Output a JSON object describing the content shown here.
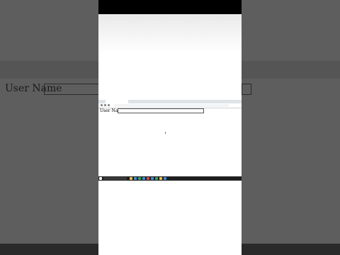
{
  "page": {
    "form_label": "User Name",
    "input_value": ""
  },
  "browser": {
    "tab_title": "",
    "url": ""
  },
  "taskbar": {
    "search_placeholder": "",
    "clock": ""
  },
  "colors": {
    "taskbar": "#1f1f1f",
    "chrome": "#dfe3e8",
    "page_bg": "#ffffff"
  }
}
